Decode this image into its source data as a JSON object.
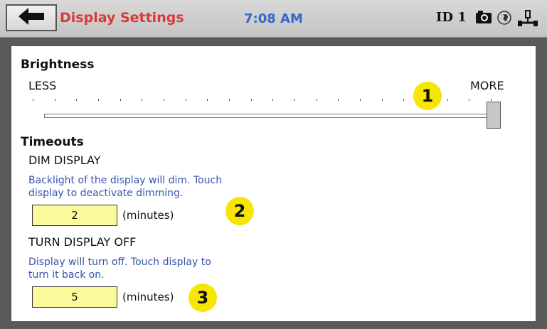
{
  "header": {
    "title": "Display Settings",
    "time": "7:08 AM",
    "device_id": "ID 1",
    "icons": [
      "back-arrow-icon",
      "camera-icon",
      "network-globe-icon",
      "usb-icon"
    ]
  },
  "brightness": {
    "heading": "Brightness",
    "less_label": "LESS",
    "more_label": "MORE",
    "level": 1.0,
    "tick_count": 22
  },
  "timeouts": {
    "heading": "Timeouts",
    "dim": {
      "label": "DIM DISPLAY",
      "note_line1": "Backlight of the display will dim.  Touch",
      "note_line2": "display to deactivate dimming.",
      "value": "2",
      "unit": "(minutes)"
    },
    "off": {
      "label": "TURN DISPLAY OFF",
      "note_line1": "Display will turn off.  Touch display to",
      "note_line2": "turn it back on.",
      "value": "5",
      "unit": "(minutes)"
    }
  },
  "callouts": [
    "1",
    "2",
    "3"
  ],
  "colors": {
    "title": "#d83a3a",
    "clock": "#3767c9",
    "note": "#3455a8",
    "input_bg": "#fbfb9c",
    "callout": "#f7e600"
  }
}
